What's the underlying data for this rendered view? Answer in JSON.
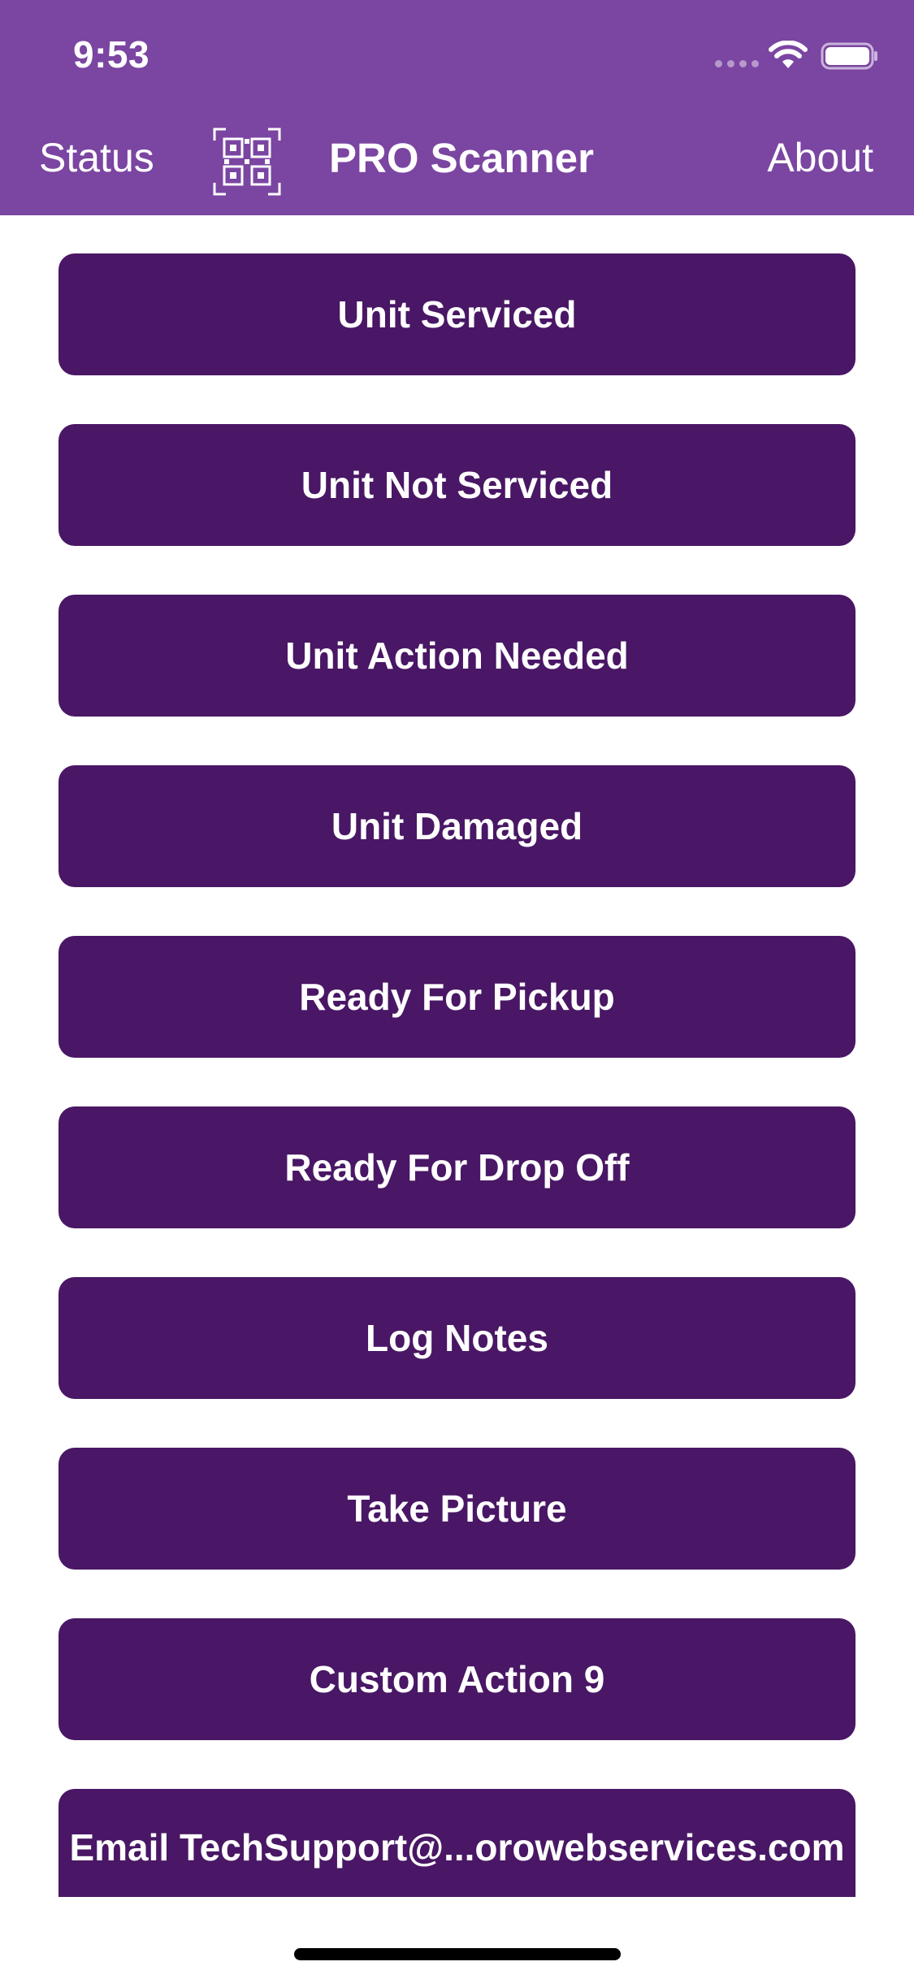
{
  "status_bar": {
    "time": "9:53"
  },
  "nav": {
    "status_label": "Status",
    "title": "PRO Scanner",
    "about_label": "About",
    "qr_icon": "qr-code-icon"
  },
  "colors": {
    "header": "#7b45a2",
    "button": "#491765",
    "button_text": "#ffffff"
  },
  "actions": [
    {
      "label": "Unit Serviced"
    },
    {
      "label": "Unit Not Serviced"
    },
    {
      "label": "Unit Action Needed"
    },
    {
      "label": "Unit Damaged"
    },
    {
      "label": "Ready For Pickup"
    },
    {
      "label": "Ready For Drop Off"
    },
    {
      "label": "Log Notes"
    },
    {
      "label": "Take Picture"
    },
    {
      "label": "Custom Action 9"
    },
    {
      "label": "Email TechSupport@...orowebservices.com"
    }
  ]
}
